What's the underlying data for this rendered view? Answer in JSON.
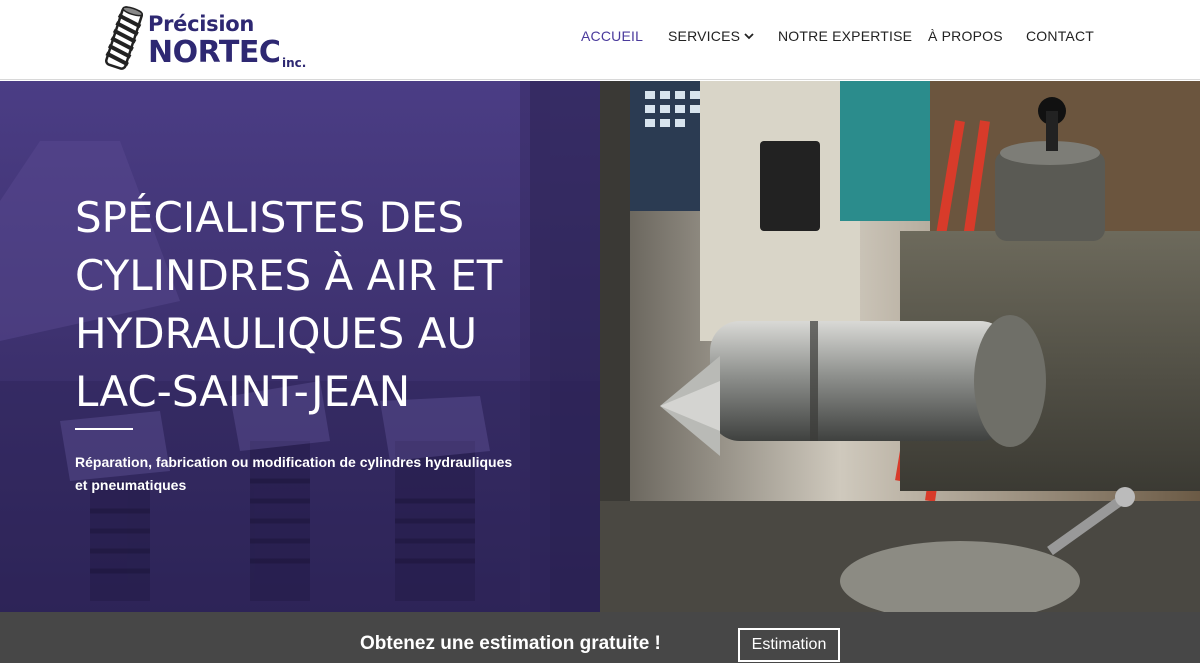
{
  "header": {
    "logo": {
      "line1": "Précision",
      "line2": "NORTEC",
      "suffix": "inc.",
      "color": "#2e2872"
    },
    "nav": [
      {
        "label": "ACCUEIL",
        "active": true
      },
      {
        "label": "SERVICES",
        "has_dropdown": true,
        "icon": "chevron-down-icon"
      },
      {
        "label": "NOTRE EXPERTISE"
      },
      {
        "label": "À PROPOS"
      },
      {
        "label": "CONTACT"
      }
    ],
    "accent_color": "#4a3a9c"
  },
  "hero": {
    "title_lines": [
      "SPÉCIALISTES DES",
      "CYLINDRES À AIR ET",
      "HYDRAULIQUES AU",
      "LAC-SAINT-JEAN"
    ],
    "subtitle": "Réparation, fabrication ou modification de cylindres hydrauliques et pneumatiques",
    "overlay_color": "#3d2f6d"
  },
  "cta": {
    "text": "Obtenez une estimation gratuite !",
    "button_label": "Estimation",
    "bar_color": "#474747"
  }
}
